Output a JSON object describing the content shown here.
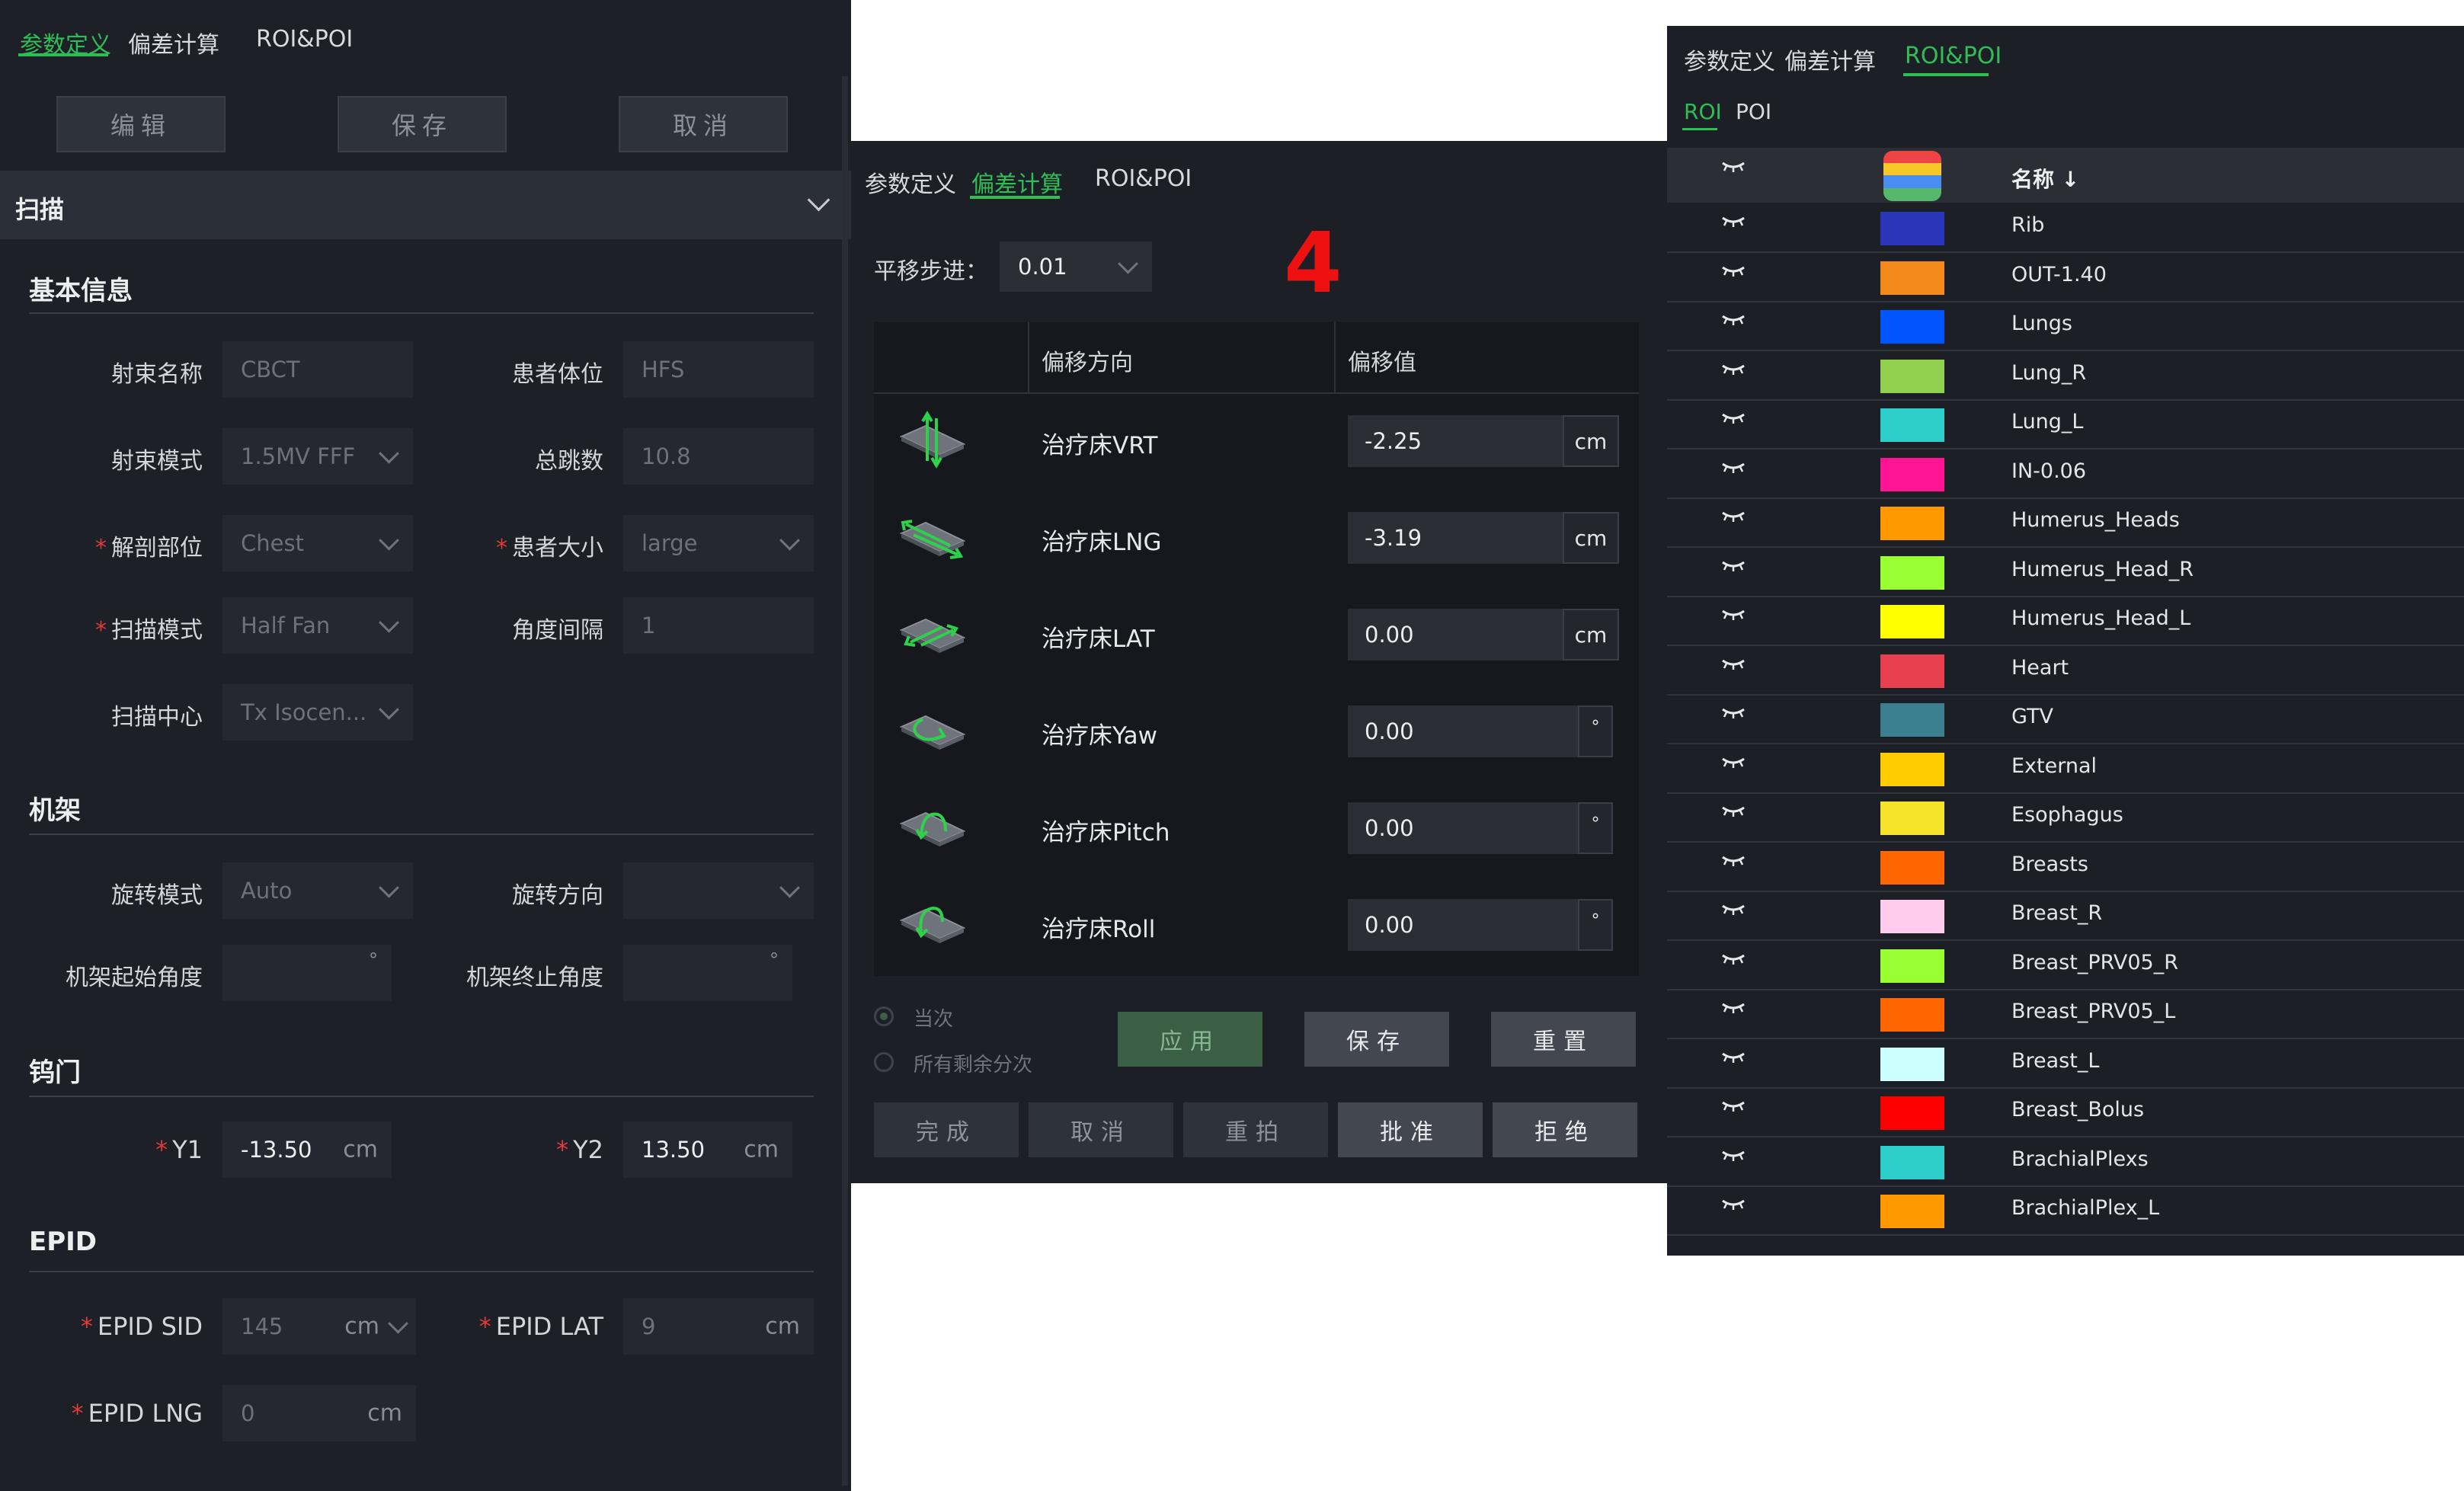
{
  "p1": {
    "tabs": [
      "参数定义",
      "偏差计算",
      "ROI&POI"
    ],
    "buttons": {
      "edit": "编辑",
      "save": "保存",
      "cancel": "取消"
    },
    "section_header": "扫描",
    "basic": {
      "title": "基本信息",
      "beam_name": {
        "label": "射束名称",
        "value": "CBCT"
      },
      "patient_pos": {
        "label": "患者体位",
        "value": "HFS"
      },
      "beam_mode": {
        "label": "射束模式",
        "value": "1.5MV FFF"
      },
      "total_mu": {
        "label": "总跳数",
        "value": "10.8"
      },
      "anatomy": {
        "label": "解剖部位",
        "value": "Chest"
      },
      "patient_size": {
        "label": "患者大小",
        "value": "large"
      },
      "scan_mode": {
        "label": "扫描模式",
        "value": "Half Fan"
      },
      "angle_interval": {
        "label": "角度间隔",
        "value": "1"
      },
      "scan_center": {
        "label": "扫描中心",
        "value": "Tx Isocen..."
      }
    },
    "gantry": {
      "title": "机架",
      "rot_mode": {
        "label": "旋转模式",
        "value": "Auto"
      },
      "rot_dir": {
        "label": "旋转方向",
        "value": ""
      },
      "start_angle": {
        "label": "机架起始角度",
        "unit": "°"
      },
      "stop_angle": {
        "label": "机架终止角度",
        "unit": "°"
      }
    },
    "jaw": {
      "title": "钨门",
      "y1": {
        "label": "Y1",
        "value": "-13.50",
        "unit": "cm"
      },
      "y2": {
        "label": "Y2",
        "value": "13.50",
        "unit": "cm"
      }
    },
    "epid": {
      "title": "EPID",
      "sid": {
        "label": "EPID SID",
        "value": "145",
        "unit": "cm"
      },
      "lat": {
        "label": "EPID LAT",
        "value": "9",
        "unit": "cm"
      },
      "lng": {
        "label": "EPID LNG",
        "value": "0",
        "unit": "cm"
      }
    }
  },
  "p2": {
    "tabs": [
      "参数定义",
      "偏差计算",
      "ROI&POI"
    ],
    "step_label": "平移步进：",
    "step_value": "0.01",
    "annotation": "4",
    "table_headers": [
      "偏移方向",
      "偏移值"
    ],
    "rows": [
      {
        "label": "治疗床VRT",
        "value": "-2.25",
        "unit": "cm"
      },
      {
        "label": "治疗床LNG",
        "value": "-3.19",
        "unit": "cm"
      },
      {
        "label": "治疗床LAT",
        "value": "0.00",
        "unit": "cm"
      },
      {
        "label": "治疗床Yaw",
        "value": "0.00",
        "unit": "°"
      },
      {
        "label": "治疗床Pitch",
        "value": "0.00",
        "unit": "°"
      },
      {
        "label": "治疗床Roll",
        "value": "0.00",
        "unit": "°"
      }
    ],
    "radio_current": "当次",
    "radio_all": "所有剩余分次",
    "btn_apply": "应用",
    "btn_save": "保存",
    "btn_reset": "重置",
    "btn_done": "完成",
    "btn_cancel": "取消",
    "btn_retake": "重拍",
    "btn_approve": "批准",
    "btn_reject": "拒绝"
  },
  "p3": {
    "tabs": [
      "参数定义",
      "偏差计算",
      "ROI&POI"
    ],
    "subtabs": [
      "ROI",
      "POI"
    ],
    "col_name": "名称",
    "sort_icon": "↓",
    "rois": [
      {
        "name": "Rib",
        "color": "#2b35b8"
      },
      {
        "name": "OUT-1.40",
        "color": "#f58a1c"
      },
      {
        "name": "Lungs",
        "color": "#0055ff"
      },
      {
        "name": "Lung_R",
        "color": "#92d050"
      },
      {
        "name": "Lung_L",
        "color": "#2ecfca"
      },
      {
        "name": "IN-0.06",
        "color": "#ff1493"
      },
      {
        "name": "Humerus_Heads",
        "color": "#ff9900"
      },
      {
        "name": "Humerus_Head_R",
        "color": "#99ff33"
      },
      {
        "name": "Humerus_Head_L",
        "color": "#ffff00"
      },
      {
        "name": "Heart",
        "color": "#e8404f"
      },
      {
        "name": "GTV",
        "color": "#3c7f8f"
      },
      {
        "name": "External",
        "color": "#ffcc00"
      },
      {
        "name": "Esophagus",
        "color": "#f5e42a"
      },
      {
        "name": "Breasts",
        "color": "#ff6600"
      },
      {
        "name": "Breast_R",
        "color": "#ffccee"
      },
      {
        "name": "Breast_PRV05_R",
        "color": "#99ff33"
      },
      {
        "name": "Breast_PRV05_L",
        "color": "#ff6600"
      },
      {
        "name": "Breast_L",
        "color": "#ccffff"
      },
      {
        "name": "Breast_Bolus",
        "color": "#ff0000"
      },
      {
        "name": "BrachialPlexs",
        "color": "#2ecfca"
      },
      {
        "name": "BrachialPlex_L",
        "color": "#ff9900"
      }
    ]
  }
}
